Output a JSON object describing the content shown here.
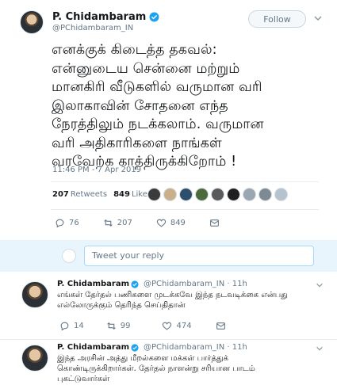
{
  "main_tweet": {
    "display_name": "P. Chidambaram",
    "handle": "@PChidambaram_IN",
    "follow_label": "Follow",
    "text_lines": [
      "எனக்குக் கிடைத்த தகவல்:",
      "என்னுடைய சென்னை மற்றும்",
      "மானகிரி வீடுகளில் வருமான வரி",
      "இலாகாவின் சோதனை எந்த",
      "நேரத்திலும் நடக்கலாம். வருமான",
      "வரி அதிகாரிகளை நாங்கள்",
      "வரவேற்க காத்திருக்கிறோம் !"
    ],
    "timestamp": "11:46 PM - 7 Apr 2019",
    "retweets_count": "207",
    "retweets_label": "Retweets",
    "likes_count": "849",
    "likes_label": "Likes",
    "actions": {
      "replies": "76",
      "retweets": "207",
      "likes": "849"
    }
  },
  "reply_box": {
    "placeholder": "Tweet your reply"
  },
  "replies": [
    {
      "display_name": "P. Chidambaram",
      "handle_time": "@PChidambaram_IN · 11h",
      "text_lines": [
        "எங்கள் தேர்தல் பணிகளை முடக்கவே இந்த நடவடிக்கை என்பது",
        "எல்லோருக்கும் தெரிந்த செய்திதான்"
      ],
      "actions": {
        "replies": "14",
        "retweets": "99",
        "likes": "474"
      }
    },
    {
      "display_name": "P. Chidambaram",
      "handle_time": "@PChidambaram_IN · 11h",
      "text_lines": [
        "இந்த அரசின் அத்து மீறல்களை மக்கள் பார்த்துக்",
        "கொண்டிருக்கிறார்கள். தேர்தல் நாளன்று சரியான பாடம்",
        "புகட்டுவார்கள்"
      ]
    }
  ],
  "colors": {
    "verified": "#1da1f2",
    "muted": "#657786",
    "reply_bg": "#e8f5fd"
  },
  "icons": [
    "verified-icon",
    "chevron-down-icon",
    "reply-icon",
    "retweet-icon",
    "heart-icon",
    "mail-icon"
  ]
}
